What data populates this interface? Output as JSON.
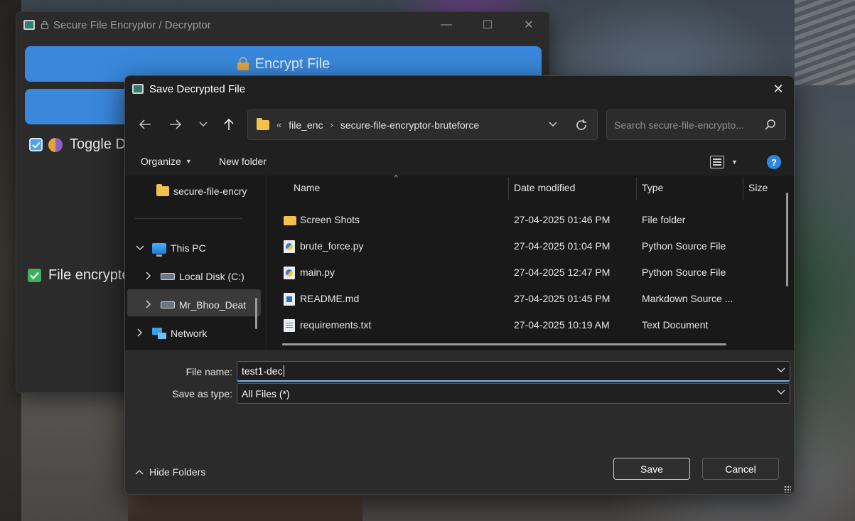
{
  "app": {
    "title": "Secure File Encryptor / Decryptor",
    "encrypt_button": "Encrypt File",
    "toggle_label": "Toggle D",
    "status_text": "File encrypte",
    "controls": {
      "minimize": "—",
      "maximize": "☐",
      "close": "✕"
    }
  },
  "dialog": {
    "title": "Save Decrypted File",
    "close": "✕",
    "breadcrumb": [
      "file_enc",
      "secure-file-encryptor-bruteforce"
    ],
    "breadcrumb_overflow": "«",
    "search_placeholder": "Search secure-file-encrypto...",
    "organize_label": "Organize",
    "new_folder_label": "New folder",
    "help_label": "?",
    "nav_items": [
      {
        "label": "secure-file-encry",
        "icon": "folder-icon"
      },
      {
        "label": "This PC",
        "icon": "pc-icon",
        "expand": "⌄"
      },
      {
        "label": "Local Disk (C:)",
        "icon": "drive-icon",
        "expand": "›"
      },
      {
        "label": "Mr_Bhoo_Deat",
        "icon": "drive-icon",
        "expand": "›"
      },
      {
        "label": "Network",
        "icon": "network-icon",
        "expand": "›"
      }
    ],
    "columns": {
      "name": "Name",
      "date": "Date modified",
      "type": "Type",
      "size": "Size"
    },
    "files": [
      {
        "name": "Screen Shots",
        "date": "27-04-2025 01:46 PM",
        "type": "File folder",
        "icon": "folder-icon"
      },
      {
        "name": "brute_force.py",
        "date": "27-04-2025 01:04 PM",
        "type": "Python Source File",
        "icon": "python-file-icon"
      },
      {
        "name": "main.py",
        "date": "27-04-2025 12:47 PM",
        "type": "Python Source File",
        "icon": "python-file-icon"
      },
      {
        "name": "README.md",
        "date": "27-04-2025 01:45 PM",
        "type": "Markdown Source ...",
        "icon": "markdown-file-icon"
      },
      {
        "name": "requirements.txt",
        "date": "27-04-2025 10:19 AM",
        "type": "Text Document",
        "icon": "text-file-icon"
      }
    ],
    "file_name_label": "File name:",
    "file_name_value": "test1-dec",
    "save_type_label": "Save as type:",
    "save_type_value": "All Files (*)",
    "hide_folders_label": "Hide Folders",
    "save_button": "Save",
    "cancel_button": "Cancel"
  }
}
